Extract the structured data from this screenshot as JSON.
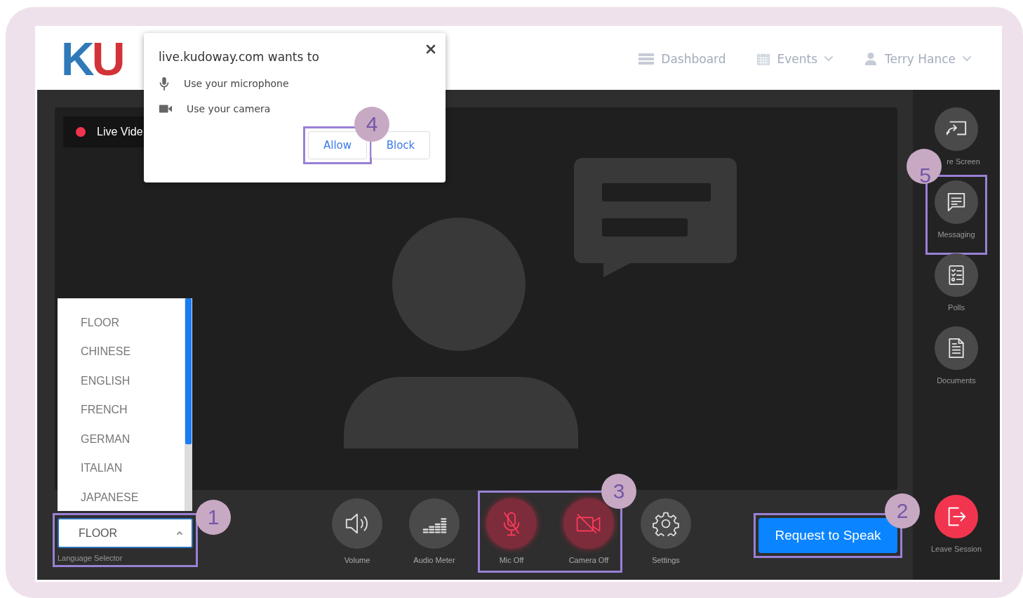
{
  "header": {
    "logo": "KU",
    "nav": [
      {
        "label": "Dashboard",
        "kind": "dashboard",
        "dropdown": false
      },
      {
        "label": "Events",
        "kind": "events",
        "dropdown": true
      },
      {
        "label": "Terry Hance",
        "kind": "user",
        "dropdown": true
      }
    ]
  },
  "permission_dialog": {
    "title": "live.kudoway.com wants to",
    "permissions": [
      {
        "label": "Use your microphone",
        "kind": "microphone"
      },
      {
        "label": "Use your camera",
        "kind": "camera"
      }
    ],
    "buttons": [
      {
        "label": "Allow",
        "callout": "4"
      },
      {
        "label": "Block"
      }
    ]
  },
  "video": {
    "live_badge": "Live Vide"
  },
  "language_selector": {
    "options": [
      "FLOOR",
      "CHINESE",
      "ENGLISH",
      "FRENCH",
      "GERMAN",
      "ITALIAN",
      "JAPANESE"
    ],
    "value": "FLOOR",
    "caption": "Language Selector",
    "expanded": true,
    "callout": "1"
  },
  "controls": [
    {
      "items": [
        {
          "label": "Volume",
          "kind": "volume",
          "off": false
        },
        {
          "label": "Audio Meter",
          "kind": "meter",
          "off": false
        }
      ]
    },
    {
      "callout": "3",
      "items": [
        {
          "label": "Mic Off",
          "kind": "mic",
          "off": true
        },
        {
          "label": "Camera Off",
          "kind": "camera",
          "off": true
        }
      ]
    },
    {
      "items": [
        {
          "label": "Settings",
          "kind": "settings",
          "off": false
        }
      ]
    }
  ],
  "request_button": {
    "label": "Request to Speak",
    "callout": "2"
  },
  "sidebar": [
    {
      "label": "re Screen",
      "kind": "share"
    },
    {
      "label": "Messaging",
      "kind": "messaging",
      "callout": "5"
    },
    {
      "label": "Polls",
      "kind": "polls"
    },
    {
      "label": "Documents",
      "kind": "documents"
    }
  ],
  "leave": {
    "label": "Leave Session"
  }
}
